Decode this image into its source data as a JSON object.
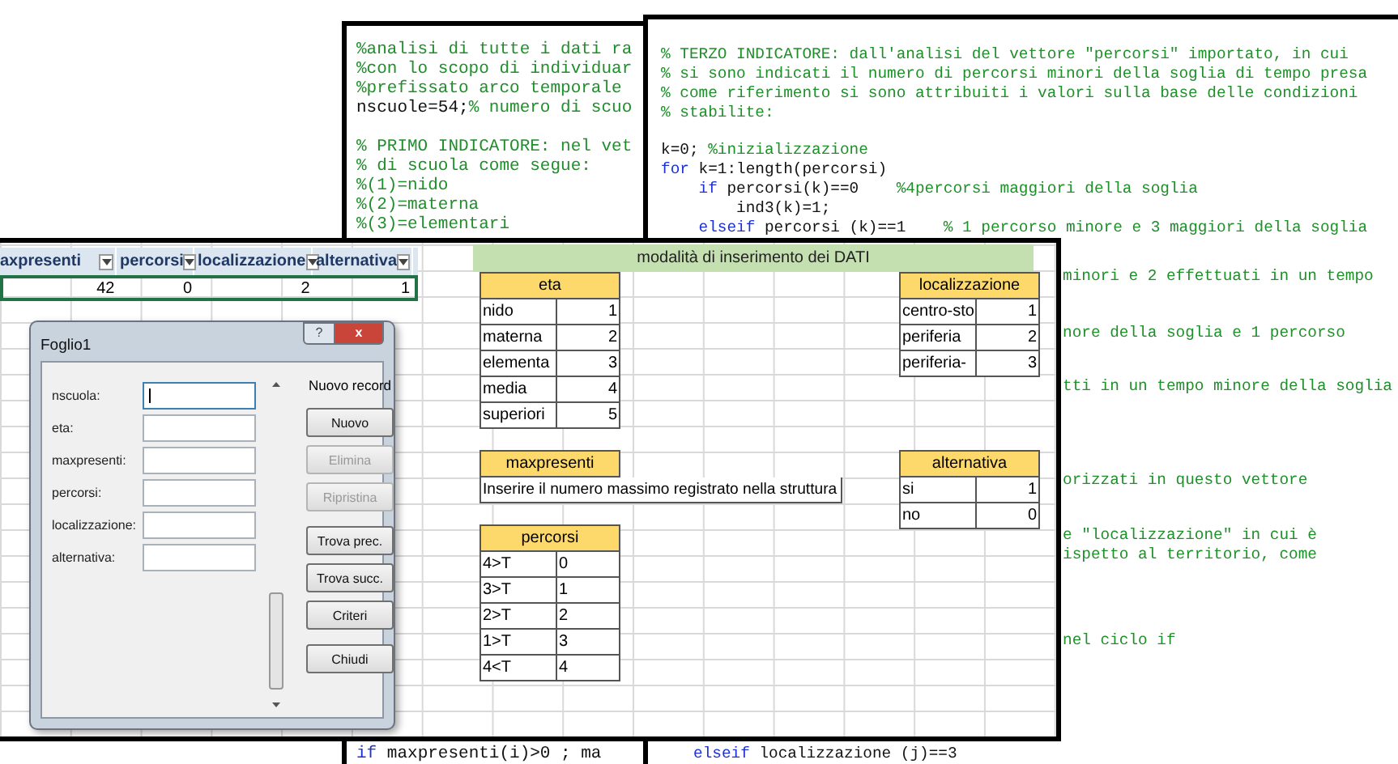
{
  "code_left": {
    "blocks": [
      [
        [
          {
            "kind": "comment",
            "text": "%analisi di tutte i dati ra"
          }
        ],
        [
          {
            "kind": "comment",
            "text": "%con lo scopo di individuar"
          }
        ],
        [
          {
            "kind": "comment",
            "text": "%prefissato arco temporale"
          }
        ],
        [
          {
            "kind": "code",
            "text": "nscuole=54;"
          },
          {
            "kind": "comment",
            "text": "% numero di scuo"
          }
        ]
      ],
      [
        [
          {
            "kind": "comment",
            "text": "% PRIMO INDICATORE: nel vet"
          }
        ],
        [
          {
            "kind": "comment",
            "text": "% di scuola come segue:"
          }
        ],
        [
          {
            "kind": "comment",
            "text": "%(1)=nido"
          }
        ],
        [
          {
            "kind": "comment",
            "text": "%(2)=materna"
          }
        ],
        [
          {
            "kind": "comment",
            "text": "%(3)=elementari"
          }
        ]
      ]
    ],
    "bottom_line": [
      {
        "kind": "keyword",
        "text": "if"
      },
      {
        "kind": "code",
        "text": " maxpresenti(i)>0 ; ma"
      }
    ]
  },
  "code_right": {
    "blocks": [
      [
        [
          {
            "kind": "comment",
            "text": "% TERZO INDICATORE: dall'analisi del vettore \"percorsi\" importato, in cui"
          }
        ],
        [
          {
            "kind": "comment",
            "text": "% si sono indicati il numero di percorsi minori della soglia di tempo presa"
          }
        ],
        [
          {
            "kind": "comment",
            "text": "% come riferimento si sono attribuiti i valori sulla base delle condizioni"
          }
        ],
        [
          {
            "kind": "comment",
            "text": "% stabilite:"
          }
        ]
      ],
      [
        [
          {
            "kind": "code",
            "text": "k=0; "
          },
          {
            "kind": "comment",
            "text": "%inizializzazione"
          }
        ],
        [
          {
            "kind": "keyword",
            "text": "for"
          },
          {
            "kind": "code",
            "text": " k=1:length(percorsi)"
          }
        ],
        [
          {
            "kind": "keyword",
            "text": "    if"
          },
          {
            "kind": "code",
            "text": " percorsi(k)==0    "
          },
          {
            "kind": "comment",
            "text": "%4percorsi maggiori della soglia"
          }
        ],
        [
          {
            "kind": "code",
            "text": "        ind3(k)=1;"
          }
        ],
        [
          {
            "kind": "keyword",
            "text": "    elseif"
          },
          {
            "kind": "code",
            "text": " percorsi (k)==1    "
          },
          {
            "kind": "comment",
            "text": "% 1 percorso minore e 3 maggiori della soglia"
          }
        ]
      ]
    ],
    "fragments": [
      "minori e 2 effettuati in un tempo",
      "nore della soglia e 1 percorso",
      "tti in un tempo minore della soglia",
      "orizzati in questo vettore",
      "e \"localizzazione\" in cui è",
      "ispetto al territorio, come",
      "nel ciclo if"
    ],
    "bottom_line": [
      {
        "kind": "keyword",
        "text": "elseif"
      },
      {
        "kind": "code",
        "text": " localizzazione (j)==3"
      }
    ]
  },
  "spreadsheet": {
    "columns": [
      "axpresenti",
      "percorsi",
      "localizzazione",
      "alternativa"
    ],
    "rows": [
      {
        "selected": true,
        "cells": [
          "42",
          "0",
          "2",
          "1"
        ]
      }
    ],
    "banner": "modalità di inserimento dei DATI",
    "tables": [
      {
        "kind": "numbers",
        "header": "eta",
        "rows": [
          [
            "nido",
            "1"
          ],
          [
            "materna",
            "2"
          ],
          [
            "elementa",
            "3"
          ],
          [
            "media",
            "4"
          ],
          [
            "superiori",
            "5"
          ]
        ]
      },
      {
        "kind": "numbers",
        "header": "localizzazione",
        "rows": [
          [
            "centro-sto",
            "1"
          ],
          [
            "periferia",
            "2"
          ],
          [
            "periferia-",
            "3"
          ]
        ]
      },
      {
        "kind": "note",
        "header": "maxpresenti",
        "text": "Inserire il numero massimo registrato nella struttura"
      },
      {
        "kind": "numbers",
        "header": "alternativa",
        "rows": [
          [
            "si",
            "1"
          ],
          [
            "no",
            "0"
          ]
        ]
      },
      {
        "kind": "text",
        "header": "percorsi",
        "rows": [
          [
            "4>T",
            "0"
          ],
          [
            "3>T",
            "1"
          ],
          [
            "2>T",
            "2"
          ],
          [
            "1>T",
            "3"
          ],
          [
            "4<T",
            "4"
          ]
        ]
      }
    ]
  },
  "dialog": {
    "title": "Foglio1",
    "help": "?",
    "close": "x",
    "fields": [
      {
        "label": "nscuola:",
        "focused": true
      },
      {
        "label": "eta:",
        "focused": false
      },
      {
        "label": "maxpresenti:",
        "focused": false
      },
      {
        "label": "percorsi:",
        "focused": false
      },
      {
        "label": "localizzazione:",
        "focused": false
      },
      {
        "label": "alternativa:",
        "focused": false
      }
    ],
    "record_status": "Nuovo record",
    "button_groups": [
      [
        {
          "label": "Nuovo",
          "disabled": false
        },
        {
          "label": "Elimina",
          "disabled": true
        },
        {
          "label": "Ripristina",
          "disabled": true
        }
      ],
      [
        {
          "label": "Trova prec.",
          "disabled": false
        },
        {
          "label": "Trova succ.",
          "disabled": false
        },
        {
          "label": "Criteri",
          "disabled": false
        }
      ],
      [
        {
          "label": "Chiudi",
          "disabled": false
        }
      ]
    ]
  }
}
